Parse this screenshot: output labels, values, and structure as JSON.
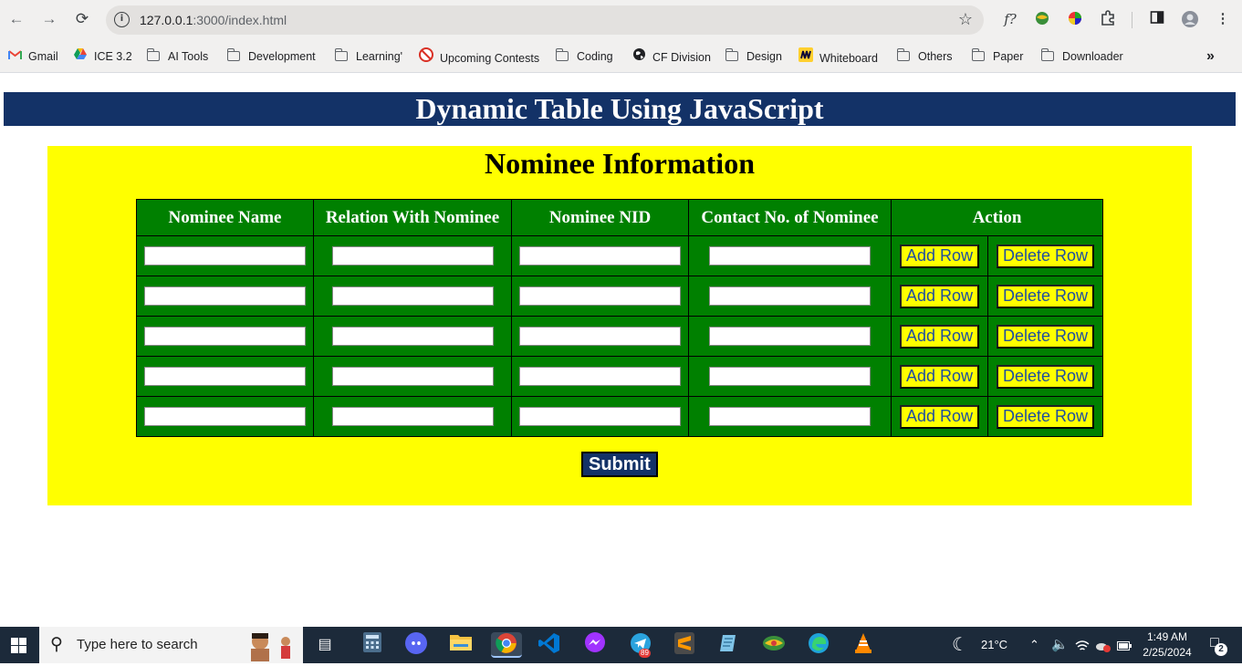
{
  "browser": {
    "url_host": "127.0.0.1",
    "url_rest": ":3000/index.html",
    "bookmarks": [
      {
        "label": "Gmail",
        "icon": "gmail-icon"
      },
      {
        "label": "ICE 3.2",
        "icon": "drive-icon"
      },
      {
        "label": "AI Tools",
        "icon": "folder-icon"
      },
      {
        "label": "Development",
        "icon": "folder-icon"
      },
      {
        "label": "Learning'",
        "icon": "folder-icon"
      },
      {
        "label": "Upcoming Contests",
        "icon": "contest-icon"
      },
      {
        "label": "Coding",
        "icon": "folder-icon"
      },
      {
        "label": "CF Division",
        "icon": "globe-icon"
      },
      {
        "label": "Design",
        "icon": "folder-icon"
      },
      {
        "label": "Whiteboard",
        "icon": "whiteboard-icon"
      },
      {
        "label": "Others",
        "icon": "folder-icon"
      },
      {
        "label": "Paper",
        "icon": "folder-icon"
      },
      {
        "label": "Downloader",
        "icon": "folder-icon"
      }
    ],
    "ext_formula_label": "f?"
  },
  "page": {
    "header": "Dynamic Table Using JavaScript",
    "section_title": "Nominee Information",
    "columns": [
      "Nominee Name",
      "Relation With Nominee",
      "Nominee NID",
      "Contact No. of Nominee",
      "Action"
    ],
    "add_row_label": "Add Row",
    "delete_row_label": "Delete Row",
    "row_count": 5,
    "submit_label": "Submit"
  },
  "taskbar": {
    "search_placeholder": "Type here to search",
    "weather": "21°C",
    "time": "1:49 AM",
    "date": "2/25/2024",
    "notification_count": "2",
    "telegram_badge": "89"
  },
  "colors": {
    "header_bg": "#133267",
    "panel_bg": "#ffff00",
    "table_bg": "#008000",
    "button_text": "#1f4ea0"
  }
}
